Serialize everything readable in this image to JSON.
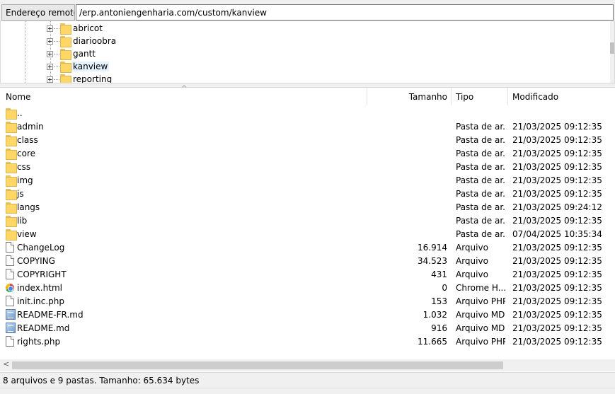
{
  "address": {
    "label": "Endereço remoto:",
    "value": "/erp.antoniengenharia.com/custom/kanview"
  },
  "tree": {
    "items": [
      {
        "label": "abricot",
        "selected": false
      },
      {
        "label": "diarioobra",
        "selected": false
      },
      {
        "label": "gantt",
        "selected": false
      },
      {
        "label": "kanview",
        "selected": true
      },
      {
        "label": "reporting",
        "selected": false
      }
    ]
  },
  "columns": {
    "name": "Nome",
    "size": "Tamanho",
    "type": "Tipo",
    "modified": "Modificado"
  },
  "files": [
    {
      "name": "..",
      "size": "",
      "type": "",
      "modified": "",
      "icon": "folder-icon"
    },
    {
      "name": "admin",
      "size": "",
      "type": "Pasta de ar...",
      "modified": "21/03/2025 09:12:35",
      "icon": "folder-icon"
    },
    {
      "name": "class",
      "size": "",
      "type": "Pasta de ar...",
      "modified": "21/03/2025 09:12:35",
      "icon": "folder-icon"
    },
    {
      "name": "core",
      "size": "",
      "type": "Pasta de ar...",
      "modified": "21/03/2025 09:12:35",
      "icon": "folder-icon"
    },
    {
      "name": "css",
      "size": "",
      "type": "Pasta de ar...",
      "modified": "21/03/2025 09:12:35",
      "icon": "folder-icon"
    },
    {
      "name": "img",
      "size": "",
      "type": "Pasta de ar...",
      "modified": "21/03/2025 09:12:35",
      "icon": "folder-icon"
    },
    {
      "name": "js",
      "size": "",
      "type": "Pasta de ar...",
      "modified": "21/03/2025 09:12:35",
      "icon": "folder-icon"
    },
    {
      "name": "langs",
      "size": "",
      "type": "Pasta de ar...",
      "modified": "21/03/2025 09:24:12",
      "icon": "folder-icon"
    },
    {
      "name": "lib",
      "size": "",
      "type": "Pasta de ar...",
      "modified": "21/03/2025 09:12:35",
      "icon": "folder-icon"
    },
    {
      "name": "view",
      "size": "",
      "type": "Pasta de ar...",
      "modified": "07/04/2025 10:35:34",
      "icon": "folder-icon"
    },
    {
      "name": "ChangeLog",
      "size": "16.914",
      "type": "Arquivo",
      "modified": "21/03/2025 09:12:35",
      "icon": "file-icon"
    },
    {
      "name": "COPYING",
      "size": "34.523",
      "type": "Arquivo",
      "modified": "21/03/2025 09:12:35",
      "icon": "file-icon"
    },
    {
      "name": "COPYRIGHT",
      "size": "431",
      "type": "Arquivo",
      "modified": "21/03/2025 09:12:35",
      "icon": "file-icon"
    },
    {
      "name": "index.html",
      "size": "0",
      "type": "Chrome H...",
      "modified": "21/03/2025 09:12:35",
      "icon": "chrome-icon"
    },
    {
      "name": "init.inc.php",
      "size": "153",
      "type": "Arquivo PHP",
      "modified": "21/03/2025 09:12:35",
      "icon": "file-icon"
    },
    {
      "name": "README-FR.md",
      "size": "1.032",
      "type": "Arquivo MD",
      "modified": "21/03/2025 09:12:35",
      "icon": "markdown-icon"
    },
    {
      "name": "README.md",
      "size": "916",
      "type": "Arquivo MD",
      "modified": "21/03/2025 09:12:35",
      "icon": "markdown-icon"
    },
    {
      "name": "rights.php",
      "size": "11.665",
      "type": "Arquivo PHP",
      "modified": "21/03/2025 09:12:35",
      "icon": "file-icon"
    }
  ],
  "status": {
    "text": "8 arquivos e 9 pastas. Tamanho: 65.634 bytes"
  },
  "scrollbar": {
    "left_arrow": "<"
  }
}
